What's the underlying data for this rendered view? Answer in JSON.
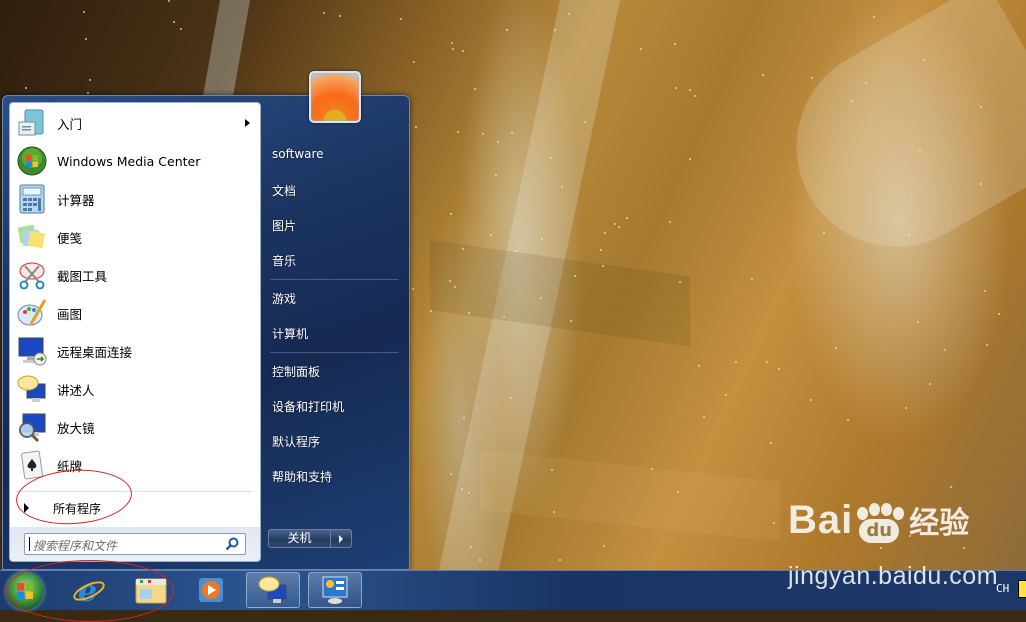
{
  "start_menu": {
    "pinned_programs": [
      {
        "label": "入门",
        "icon": "getting-started-icon",
        "has_submenu": true
      },
      {
        "label": "Windows Media Center",
        "icon": "media-center-icon",
        "has_submenu": false
      },
      {
        "label": "计算器",
        "icon": "calculator-icon",
        "has_submenu": false
      },
      {
        "label": "便笺",
        "icon": "sticky-notes-icon",
        "has_submenu": false
      },
      {
        "label": "截图工具",
        "icon": "snipping-tool-icon",
        "has_submenu": false
      },
      {
        "label": "画图",
        "icon": "paint-icon",
        "has_submenu": false
      },
      {
        "label": "远程桌面连接",
        "icon": "remote-desktop-icon",
        "has_submenu": false
      },
      {
        "label": "讲述人",
        "icon": "narrator-icon",
        "has_submenu": false
      },
      {
        "label": "放大镜",
        "icon": "magnifier-icon",
        "has_submenu": false
      },
      {
        "label": "纸牌",
        "icon": "solitaire-icon",
        "has_submenu": false
      }
    ],
    "all_programs_label": "所有程序",
    "search": {
      "placeholder": "搜索程序和文件",
      "value": ""
    },
    "right_pane": [
      {
        "label": "software"
      },
      {
        "label": "文档"
      },
      {
        "label": "图片"
      },
      {
        "label": "音乐"
      },
      {
        "label": "游戏"
      },
      {
        "label": "计算机"
      },
      {
        "label": "控制面板"
      },
      {
        "label": "设备和打印机"
      },
      {
        "label": "默认程序"
      },
      {
        "label": "帮助和支持"
      }
    ],
    "shutdown_label": "关机"
  },
  "taskbar": {
    "buttons": [
      {
        "name": "internet-explorer",
        "icon": "ie-icon"
      },
      {
        "name": "windows-explorer",
        "icon": "folder-icon"
      },
      {
        "name": "media-player",
        "icon": "media-player-icon"
      },
      {
        "name": "narrator",
        "icon": "narrator-icon",
        "active": true
      },
      {
        "name": "control-panel",
        "icon": "control-panel-icon",
        "active": true
      }
    ],
    "tray": {
      "language": "CH"
    }
  },
  "watermark": {
    "brand": "Bai",
    "brand_du": "du",
    "cn": "经验",
    "url": "jingyan.baidu.com"
  }
}
